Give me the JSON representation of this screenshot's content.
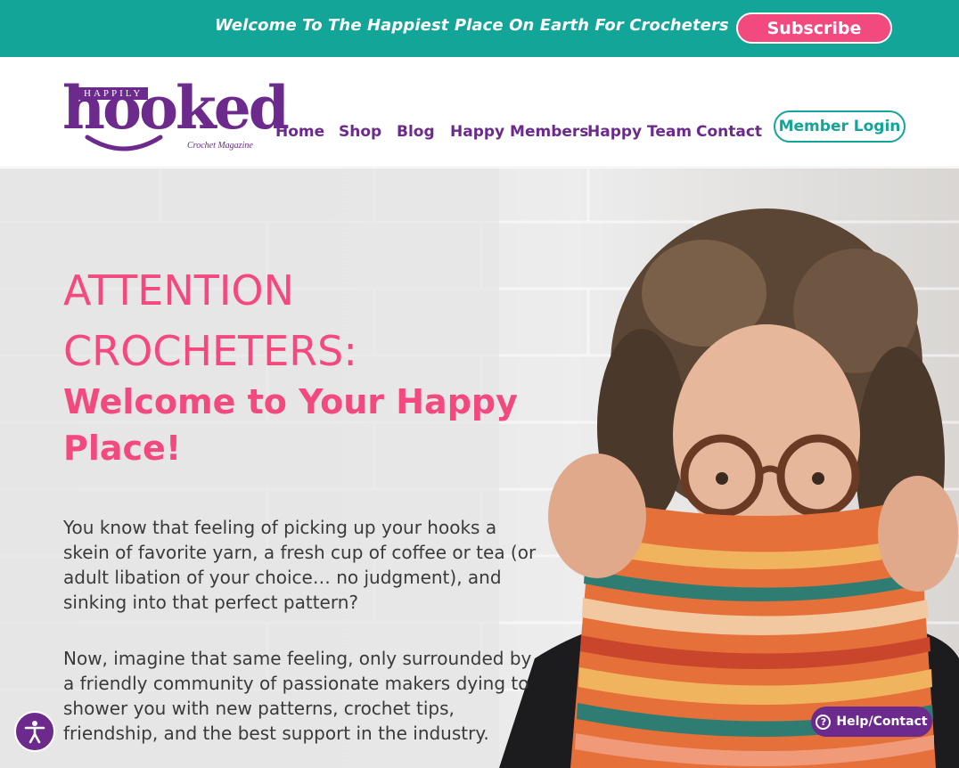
{
  "topbar": {
    "welcome_text": "Welcome To The Happiest Place On Earth For Crocheters",
    "subscribe_label": "Subscribe"
  },
  "logo": {
    "top_word": "HAPPILY",
    "main_word": "hooked",
    "tagline": "Crochet Magazine"
  },
  "nav": {
    "items": [
      {
        "label": "Home"
      },
      {
        "label": "Shop"
      },
      {
        "label": "Blog"
      },
      {
        "label": "Happy Members"
      },
      {
        "label": "Happy Team"
      },
      {
        "label": "Contact"
      }
    ],
    "member_login_label": "Member Login"
  },
  "hero": {
    "heading_line1": "ATTENTION",
    "heading_line2": "CROCHETERS:",
    "subheading": "Welcome to Your Happy Place!",
    "paragraph1": "You know that feeling of picking up your hooks a skein of favorite yarn, a fresh cup of coffee or tea (or adult libation of your choice… no judgment), and sinking into that perfect pattern?",
    "paragraph2": "Now, imagine that same feeling, only surrounded by a friendly community of passionate makers dying to shower you with new patterns, crochet tips, friendship, and the best support in the industry."
  },
  "widgets": {
    "help_label": "Help/Contact",
    "help_icon": "?",
    "accessibility_icon": "accessibility-person-icon"
  },
  "colors": {
    "teal": "#13a597",
    "pink": "#f2497f",
    "purple": "#6b2a8c"
  }
}
